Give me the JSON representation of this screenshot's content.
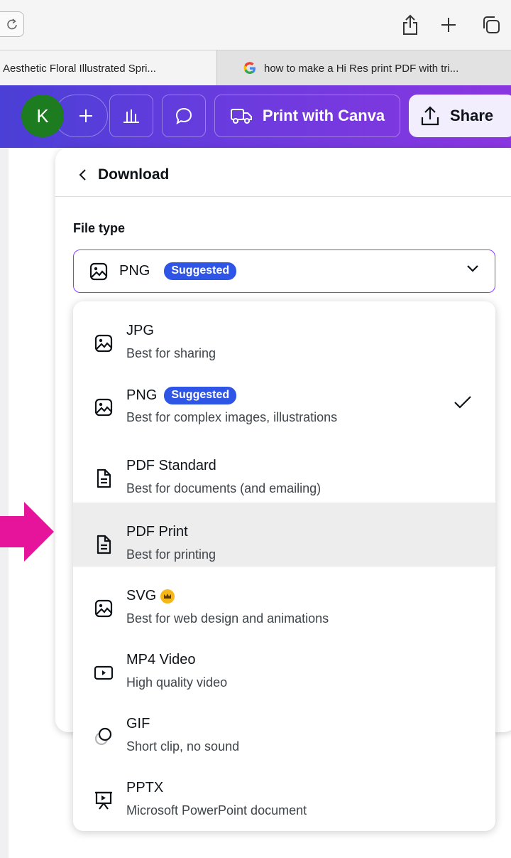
{
  "browser": {
    "tabs": [
      {
        "title": "Aesthetic Floral Illustrated Spri..."
      },
      {
        "title": "how to make a Hi Res print PDF with tri..."
      }
    ]
  },
  "header": {
    "avatar_initial": "K",
    "print_label": "Print with Canva",
    "share_label": "Share"
  },
  "download": {
    "title": "Download",
    "file_type_label": "File type",
    "selected_value": "PNG",
    "selected_badge": "Suggested"
  },
  "file_types": [
    {
      "title": "JPG",
      "subtitle": "Best for sharing",
      "icon": "image-icon"
    },
    {
      "title": "PNG",
      "badge": "Suggested",
      "subtitle": "Best for complex images, illustrations",
      "icon": "image-icon",
      "selected": true
    },
    {
      "title": "PDF Standard",
      "subtitle": "Best for documents (and emailing)",
      "icon": "document-icon"
    },
    {
      "title": "PDF Print",
      "subtitle": "Best for printing",
      "icon": "document-icon",
      "highlighted": true
    },
    {
      "title": "SVG",
      "subtitle": "Best for web design and animations",
      "icon": "image-icon",
      "premium": true
    },
    {
      "title": "MP4 Video",
      "subtitle": "High quality video",
      "icon": "video-icon"
    },
    {
      "title": "GIF",
      "subtitle": "Short clip, no sound",
      "icon": "gif-icon"
    },
    {
      "title": "PPTX",
      "subtitle": "Microsoft PowerPoint document",
      "icon": "presentation-icon"
    }
  ],
  "colors": {
    "accent": "#8b3dff",
    "badge": "#2f55e6",
    "avatar": "#1c7c1f",
    "arrow": "#e6149a",
    "premium": "#f6b816"
  }
}
